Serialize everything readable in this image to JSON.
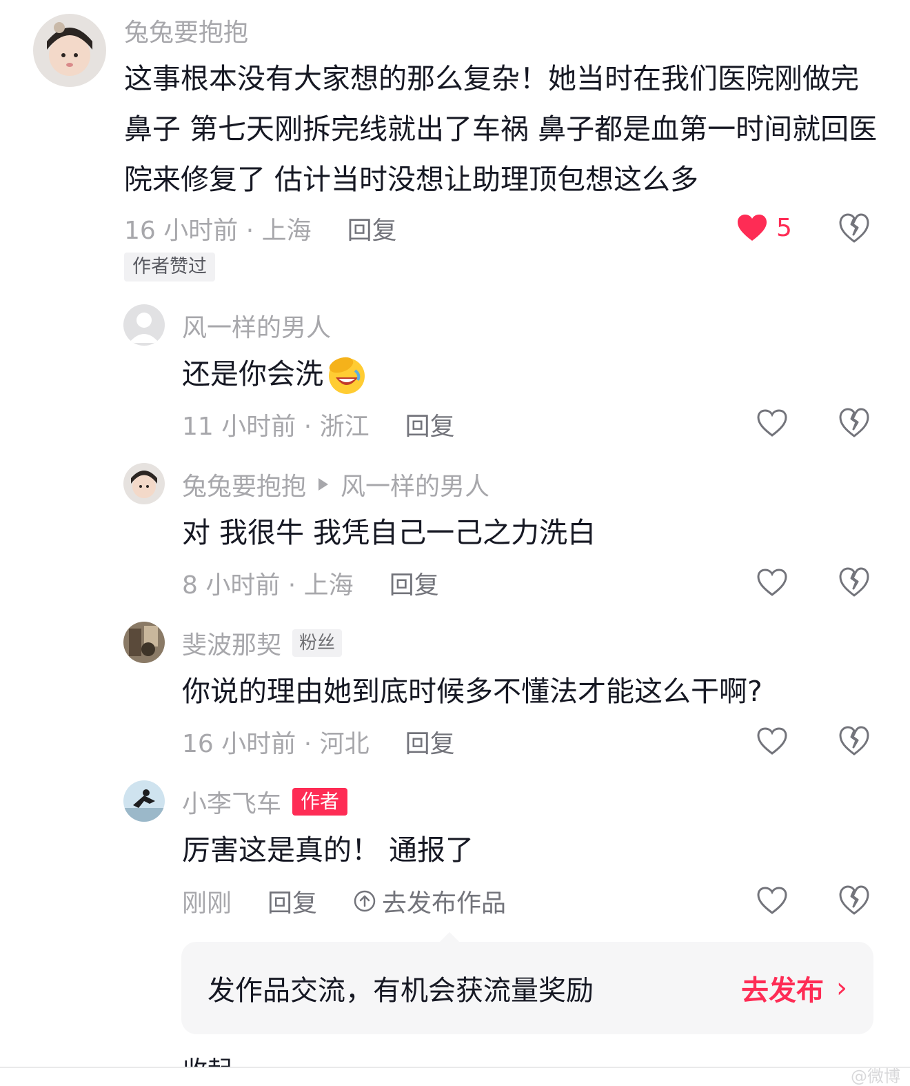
{
  "colors": {
    "accent": "#fe2c55",
    "muted": "#a7a7ab",
    "text": "#161823"
  },
  "comment": {
    "username": "兔兔要抱抱",
    "text": "这事根本没有大家想的那么复杂！她当时在我们医院刚做完鼻子 第七天刚拆完线就出了车祸 鼻子都是血第一时间就回医院来修复了 估计当时没想让助理顶包想这么多",
    "time_location": "16 小时前 · 上海",
    "reply_label": "回复",
    "like_count": "5",
    "liked": true,
    "author_liked_badge": "作者赞过"
  },
  "replies": [
    {
      "username": "风一样的男人",
      "text": "还是你会洗",
      "emoji": "face-palm-laughing",
      "time_location": "11 小时前 · 浙江",
      "reply_label": "回复"
    },
    {
      "username": "兔兔要抱抱",
      "reply_to": "风一样的男人",
      "text": "对 我很牛 我凭自己一己之力洗白",
      "time_location": "8 小时前 · 上海",
      "reply_label": "回复"
    },
    {
      "username": "斐波那契",
      "tag": "粉丝",
      "text": "你说的理由她到底时候多不懂法才能这么干啊?",
      "time_location": "16 小时前 · 河北",
      "reply_label": "回复"
    },
    {
      "username": "小李飞车",
      "tag": "作者",
      "text": "厉害这是真的！ 通报了",
      "time_location": "刚刚",
      "reply_label": "回复",
      "publish_label": "去发布作品"
    }
  ],
  "promo": {
    "text": "发作品交流，有机会获流量奖励",
    "button_label": "去发布",
    "chevron": "›"
  },
  "collapse_partial": "收起",
  "watermark": "@微博"
}
